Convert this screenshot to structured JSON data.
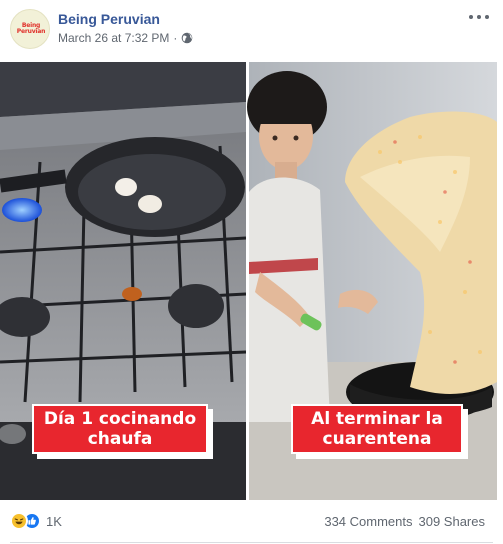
{
  "post": {
    "page_name": "Being Peruvian",
    "avatar_text": "Being\nPeruvian",
    "date": "March 26 at 7:32 PM",
    "separator": "·",
    "privacy_icon": "globe-icon",
    "more_icon": "more-horizontal-icon"
  },
  "image": {
    "left_caption": "Día 1 cocinando chaufa",
    "right_caption": "Al terminar la cuarentena",
    "caption_color": "#e8262e"
  },
  "engagement": {
    "reaction_icons": [
      "haha-icon",
      "like-icon"
    ],
    "reaction_count": "1K",
    "comments": "334 Comments",
    "shares": "309 Shares"
  },
  "colors": {
    "link": "#385898",
    "meta": "#606770",
    "like": "#1877f2",
    "haha": "#f7c02d"
  }
}
